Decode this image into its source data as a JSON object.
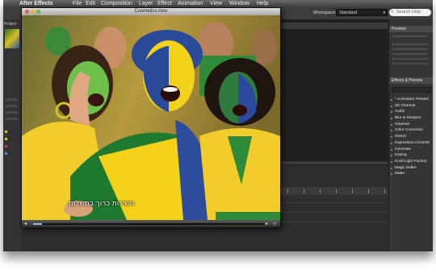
{
  "menubar": {
    "app": "After Effects",
    "items": [
      "File",
      "Edit",
      "Composition",
      "Layer",
      "Effect",
      "Animation",
      "View",
      "Window",
      "Help"
    ]
  },
  "toolbar": {
    "workspace_label": "Workspace:",
    "workspace_value": "Standard",
    "search_placeholder": "Search Help"
  },
  "project_panel": {
    "tab": "Project"
  },
  "video_window": {
    "title": "Cosmetics.mov",
    "subtitle": "השירות כרוך בתשלום",
    "playback_progress": 0.04
  },
  "right_panel": {
    "preview_title": "Preview",
    "effects_title": "Effects & Presets",
    "effects": [
      "* Animation Presets",
      "3D Channel",
      "Audio",
      "Blur & Sharpen",
      "Channel",
      "Color Correction",
      "Distort",
      "Expression Controls",
      "Generate",
      "Keying",
      "Knoll Light Factory",
      "Magic Bullet",
      "Matte"
    ]
  },
  "colors": {
    "app_bg": "#2b2b2b",
    "panel_bg": "#353535",
    "flag_green": "#1f8a3a",
    "flag_yellow": "#f4d21a",
    "flag_blue": "#1f3f9a"
  },
  "icons": [
    "search-icon",
    "play-icon",
    "volume-icon",
    "close-dot-icon",
    "minimize-dot-icon",
    "zoom-dot-icon"
  ]
}
